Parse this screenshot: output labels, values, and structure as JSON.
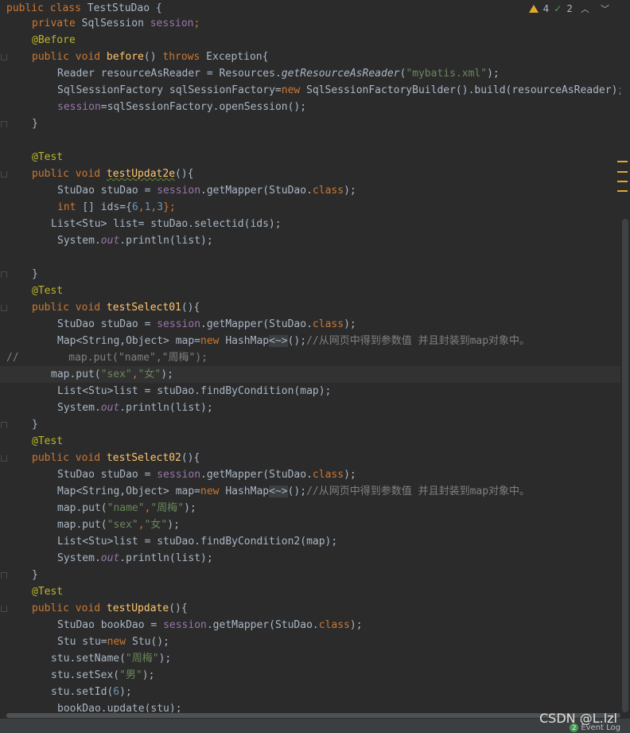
{
  "inspection": {
    "warnings": "4",
    "weak_warnings": "2"
  },
  "code": {
    "l1": [
      "public class ",
      "TestStuDao",
      " {"
    ],
    "l2": [
      "private ",
      "SqlSession ",
      "session",
      ";"
    ],
    "l3": [
      "@Before"
    ],
    "l4": [
      "public void ",
      "before",
      "() ",
      "throws ",
      "Exception{"
    ],
    "l5": [
      "Reader resourceAsReader = Resources.",
      "getResourceAsReader",
      "(",
      "\"mybatis.xml\"",
      ");"
    ],
    "l6": [
      "SqlSessionFactory sqlSessionFactory=",
      "new ",
      "SqlSessionFactoryBuilder().build(resourceAsReader);"
    ],
    "l7": [
      "session",
      "=sqlSessionFactory.openSession();"
    ],
    "l8": [
      "}"
    ],
    "l9": [
      "@Test"
    ],
    "l10": [
      "public void ",
      "testUpdat2e",
      "(){"
    ],
    "l11": [
      "StuDao stuDao = ",
      "session",
      ".getMapper(StuDao.",
      "class",
      ");"
    ],
    "l12": [
      "int ",
      "[] ids={",
      "6",
      ",",
      "1",
      ",",
      "3",
      "};"
    ],
    "l13": [
      "List<Stu> list= stuDao.selectid(ids);"
    ],
    "l14": [
      "System.",
      "out",
      ".println(list);"
    ],
    "l15": [
      "}"
    ],
    "l16": [
      "@Test"
    ],
    "l17": [
      "public void ",
      "testSelect01",
      "(){"
    ],
    "l18": [
      "StuDao stuDao = ",
      "session",
      ".getMapper(StuDao.",
      "class",
      ");"
    ],
    "l19": [
      "Map<String,Object> map=",
      "new ",
      "HashMap",
      "<~>",
      "();",
      "//从网页中得到参数值 并且封装到map对象中。"
    ],
    "l20": [
      "//        map.put(\"name\",\"周梅\");"
    ],
    "l21": [
      "map.put(",
      "\"sex\"",
      ",",
      "\"女\"",
      ");"
    ],
    "l22": [
      "List<Stu>list = stuDao.findByCondition(map);"
    ],
    "l23": [
      "System.",
      "out",
      ".println(list);"
    ],
    "l24": [
      "}"
    ],
    "l25": [
      "@Test"
    ],
    "l26": [
      "public void ",
      "testSelect02",
      "(){"
    ],
    "l27": [
      "StuDao stuDao = ",
      "session",
      ".getMapper(StuDao.",
      "class",
      ");"
    ],
    "l28": [
      "Map<String,Object> map=",
      "new ",
      "HashMap",
      "<~>",
      "();",
      "//从网页中得到参数值 并且封装到map对象中。"
    ],
    "l29": [
      "map.put(",
      "\"name\"",
      ",",
      "\"周梅\"",
      ");"
    ],
    "l30": [
      "map.put(",
      "\"sex\"",
      ",",
      "\"女\"",
      ");"
    ],
    "l31": [
      "List<Stu>list = stuDao.findByCondition2(map);"
    ],
    "l32": [
      "System.",
      "out",
      ".println(list);"
    ],
    "l33": [
      "}"
    ],
    "l34": [
      "@Test"
    ],
    "l35": [
      "public void ",
      "testUpdate",
      "(){"
    ],
    "l36": [
      "StuDao bookDao = ",
      "session",
      ".getMapper(StuDao.",
      "class",
      ");"
    ],
    "l37": [
      "Stu stu=",
      "new ",
      "Stu();"
    ],
    "l38": [
      "stu.setName(",
      "\"周梅\"",
      ");"
    ],
    "l39": [
      "stu.setSex(",
      "\"男\"",
      ");"
    ],
    "l40": [
      "stu.setId(",
      "6",
      ");"
    ],
    "l41": [
      "bookDao.update(stu);"
    ]
  },
  "watermark": "CSDN @L.lzl",
  "event_log": {
    "count": "2",
    "label": "Event Log"
  },
  "colors": {
    "background": "#2b2b2b",
    "keyword": "#cc7832",
    "method": "#ffc66d",
    "string": "#6a8759",
    "number": "#6897bb",
    "field": "#9876aa",
    "annotation": "#bbb529",
    "comment": "#808080"
  }
}
